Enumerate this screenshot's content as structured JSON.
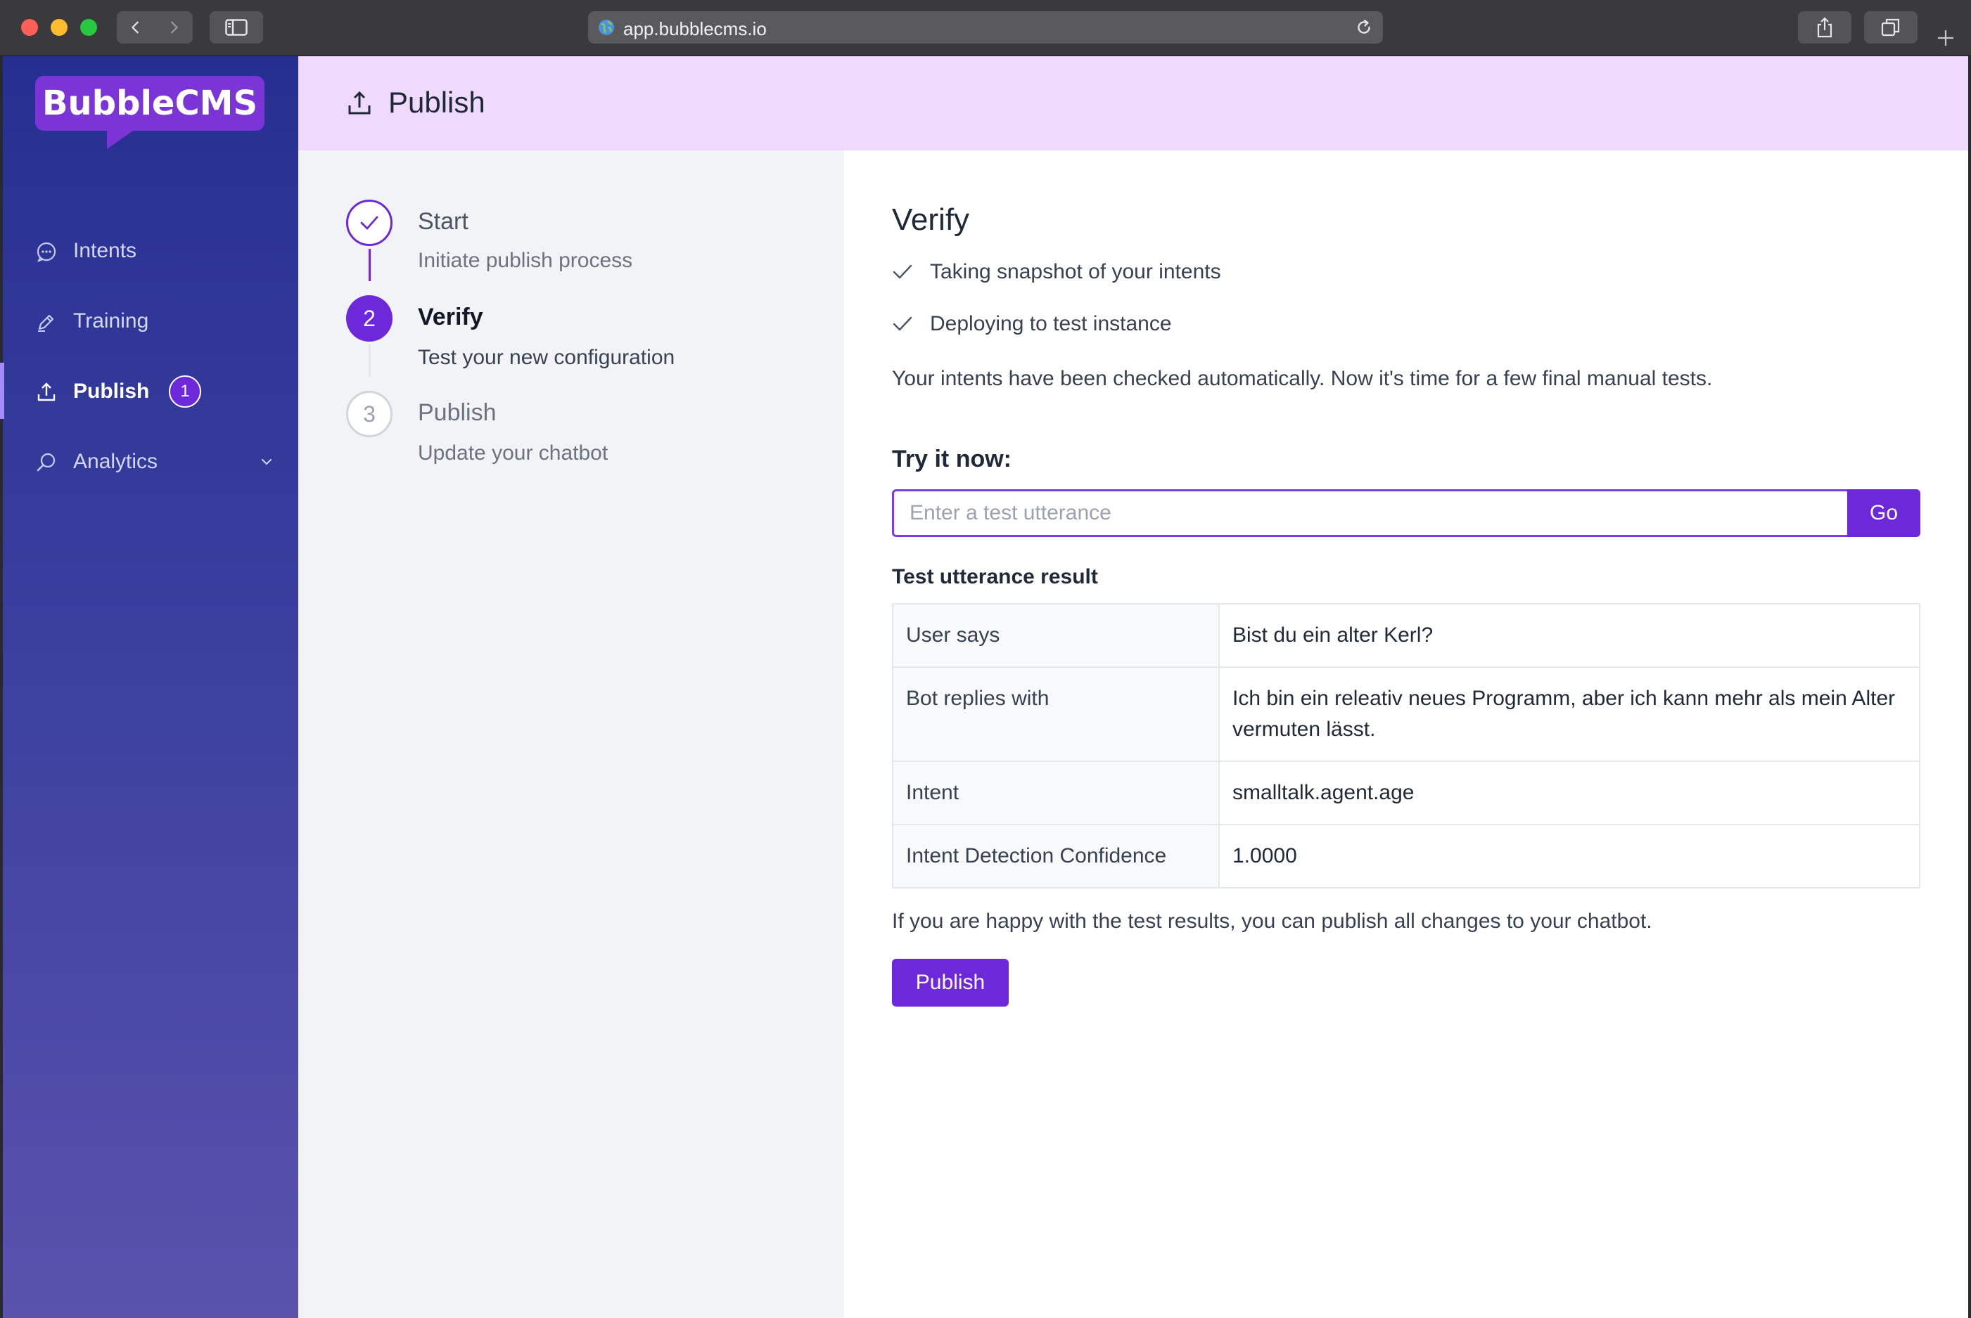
{
  "browser": {
    "url": "app.bubblecms.io"
  },
  "app": {
    "logo_text": "BubbleCMS"
  },
  "sidebar": {
    "items": [
      {
        "label": "Intents",
        "icon": "chat-bubble-icon"
      },
      {
        "label": "Training",
        "icon": "pen-icon"
      },
      {
        "label": "Publish",
        "icon": "upload-icon",
        "badge": "1",
        "active": true
      },
      {
        "label": "Analytics",
        "icon": "search-icon",
        "expandable": true
      }
    ]
  },
  "header": {
    "title": "Publish",
    "icon": "upload-icon"
  },
  "steps": [
    {
      "number": "1",
      "title": "Start",
      "subtitle": "Initiate publish process",
      "state": "done"
    },
    {
      "number": "2",
      "title": "Verify",
      "subtitle": "Test your new configuration",
      "state": "current"
    },
    {
      "number": "3",
      "title": "Publish",
      "subtitle": "Update your chatbot",
      "state": "upcoming"
    }
  ],
  "verify": {
    "title": "Verify",
    "checks": [
      "Taking snapshot of your intents",
      "Deploying to test instance"
    ],
    "info": "Your intents have been checked automatically. Now it's time for a few final manual tests.",
    "try_label": "Try it now:",
    "input_placeholder": "Enter a test utterance",
    "input_value": "",
    "go_label": "Go",
    "result_title": "Test utterance result",
    "results": [
      {
        "key": "User says",
        "value": "Bist du ein alter Kerl?"
      },
      {
        "key": "Bot replies with",
        "value": "Ich bin ein releativ neues Programm, aber ich kann mehr als mein Alter vermuten lässt."
      },
      {
        "key": "Intent",
        "value": "smalltalk.agent.age"
      },
      {
        "key": "Intent Detection Confidence",
        "value": "1.0000"
      }
    ],
    "happy_text": "If you are happy with the test results, you can publish all changes to your chatbot.",
    "publish_label": "Publish"
  },
  "colors": {
    "accent": "#6d28d9",
    "header_bg": "#efdafe",
    "sidebar_top": "#262f91",
    "sidebar_bottom": "#5a52ad"
  }
}
